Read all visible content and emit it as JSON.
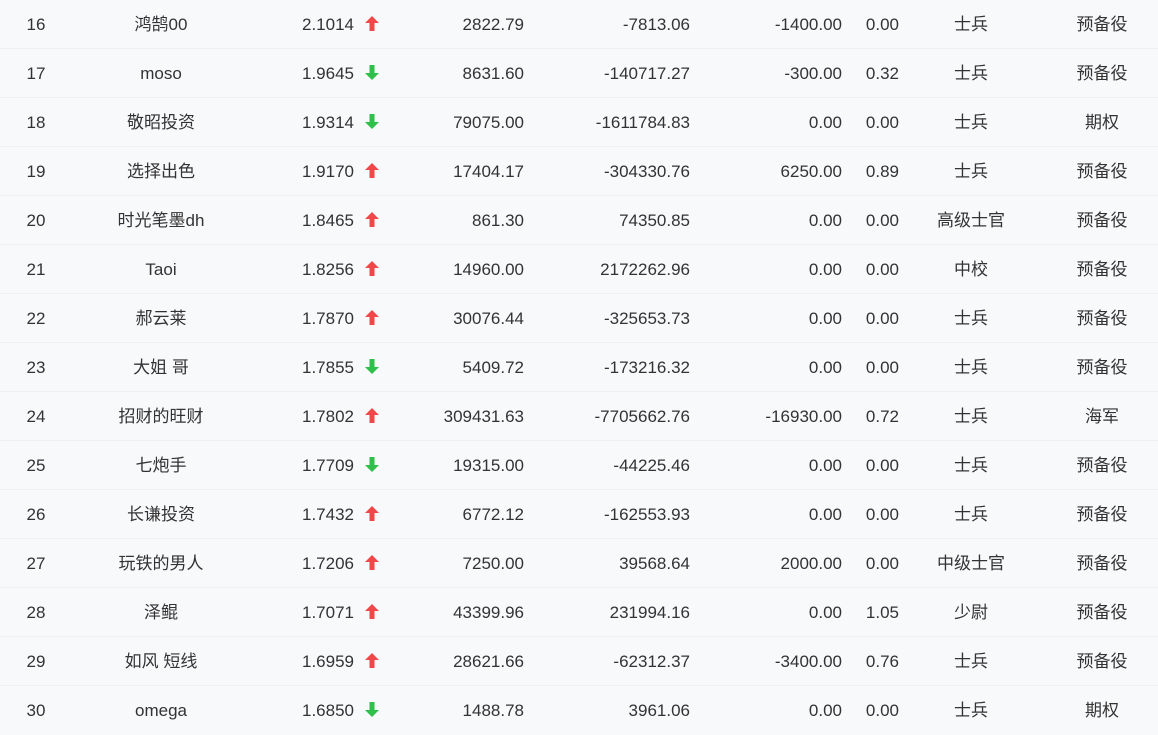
{
  "colors": {
    "up": "#f04848",
    "down": "#2ec04a",
    "text": "#333333",
    "background": "#f8f9fb"
  },
  "rows": [
    {
      "rank": "16",
      "name": "鸿鹄00",
      "score": "2.1014",
      "trend": "up",
      "asset": "2822.79",
      "profit": "-7813.06",
      "today": "-1400.00",
      "ratio": "0.00",
      "level": "士兵",
      "type": "预备役"
    },
    {
      "rank": "17",
      "name": "moso",
      "score": "1.9645",
      "trend": "down",
      "asset": "8631.60",
      "profit": "-140717.27",
      "today": "-300.00",
      "ratio": "0.32",
      "level": "士兵",
      "type": "预备役"
    },
    {
      "rank": "18",
      "name": "敬昭投资",
      "score": "1.9314",
      "trend": "down",
      "asset": "79075.00",
      "profit": "-1611784.83",
      "today": "0.00",
      "ratio": "0.00",
      "level": "士兵",
      "type": "期权"
    },
    {
      "rank": "19",
      "name": "选择出色",
      "score": "1.9170",
      "trend": "up",
      "asset": "17404.17",
      "profit": "-304330.76",
      "today": "6250.00",
      "ratio": "0.89",
      "level": "士兵",
      "type": "预备役"
    },
    {
      "rank": "20",
      "name": "时光笔墨dh",
      "score": "1.8465",
      "trend": "up",
      "asset": "861.30",
      "profit": "74350.85",
      "today": "0.00",
      "ratio": "0.00",
      "level": "高级士官",
      "type": "预备役"
    },
    {
      "rank": "21",
      "name": "Taoi",
      "score": "1.8256",
      "trend": "up",
      "asset": "14960.00",
      "profit": "2172262.96",
      "today": "0.00",
      "ratio": "0.00",
      "level": "中校",
      "type": "预备役"
    },
    {
      "rank": "22",
      "name": "郝云莱",
      "score": "1.7870",
      "trend": "up",
      "asset": "30076.44",
      "profit": "-325653.73",
      "today": "0.00",
      "ratio": "0.00",
      "level": "士兵",
      "type": "预备役"
    },
    {
      "rank": "23",
      "name": "大姐 哥",
      "score": "1.7855",
      "trend": "down",
      "asset": "5409.72",
      "profit": "-173216.32",
      "today": "0.00",
      "ratio": "0.00",
      "level": "士兵",
      "type": "预备役"
    },
    {
      "rank": "24",
      "name": "招财的旺财",
      "score": "1.7802",
      "trend": "up",
      "asset": "309431.63",
      "profit": "-7705662.76",
      "today": "-16930.00",
      "ratio": "0.72",
      "level": "士兵",
      "type": "海军"
    },
    {
      "rank": "25",
      "name": "七炮手",
      "score": "1.7709",
      "trend": "down",
      "asset": "19315.00",
      "profit": "-44225.46",
      "today": "0.00",
      "ratio": "0.00",
      "level": "士兵",
      "type": "预备役"
    },
    {
      "rank": "26",
      "name": "长谦投资",
      "score": "1.7432",
      "trend": "up",
      "asset": "6772.12",
      "profit": "-162553.93",
      "today": "0.00",
      "ratio": "0.00",
      "level": "士兵",
      "type": "预备役"
    },
    {
      "rank": "27",
      "name": "玩铁的男人",
      "score": "1.7206",
      "trend": "up",
      "asset": "7250.00",
      "profit": "39568.64",
      "today": "2000.00",
      "ratio": "0.00",
      "level": "中级士官",
      "type": "预备役"
    },
    {
      "rank": "28",
      "name": "泽鲲",
      "score": "1.7071",
      "trend": "up",
      "asset": "43399.96",
      "profit": "231994.16",
      "today": "0.00",
      "ratio": "1.05",
      "level": "少尉",
      "type": "预备役"
    },
    {
      "rank": "29",
      "name": "如风 短线",
      "score": "1.6959",
      "trend": "up",
      "asset": "28621.66",
      "profit": "-62312.37",
      "today": "-3400.00",
      "ratio": "0.76",
      "level": "士兵",
      "type": "预备役"
    },
    {
      "rank": "30",
      "name": "omega",
      "score": "1.6850",
      "trend": "down",
      "asset": "1488.78",
      "profit": "3961.06",
      "today": "0.00",
      "ratio": "0.00",
      "level": "士兵",
      "type": "期权"
    }
  ]
}
